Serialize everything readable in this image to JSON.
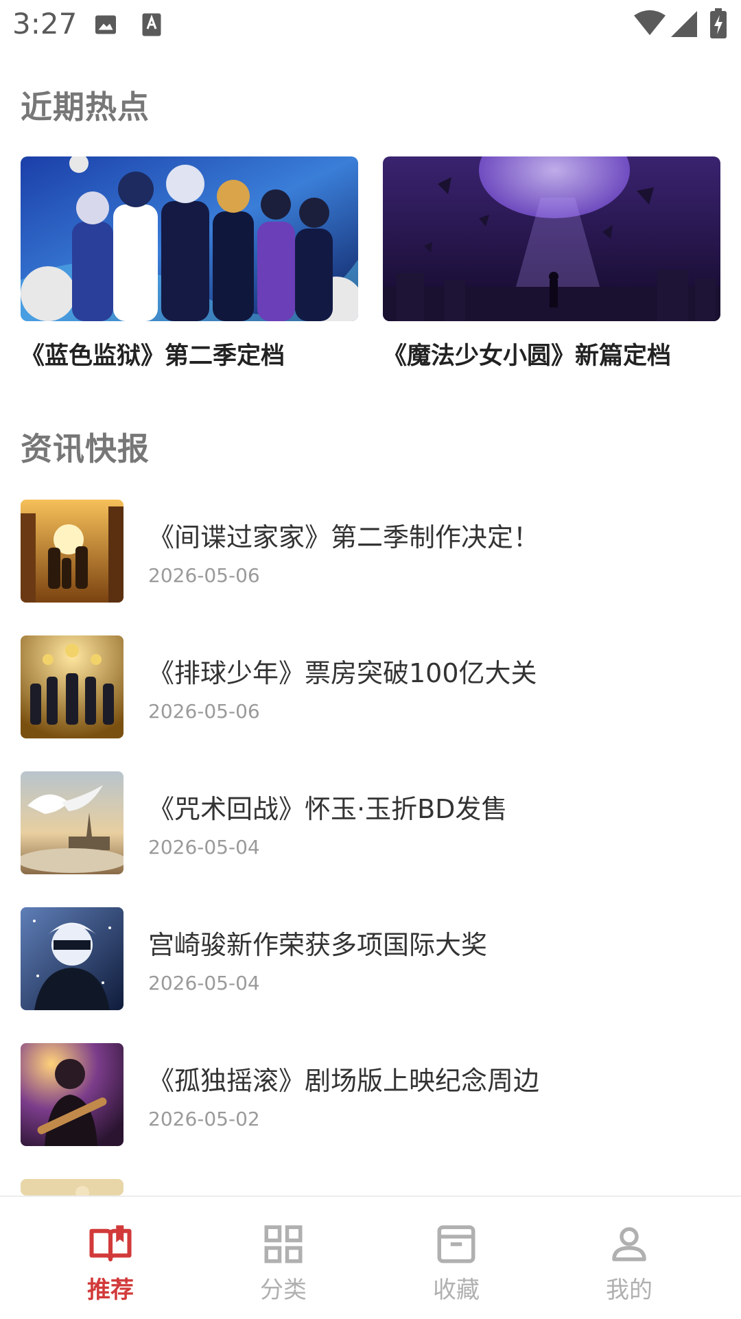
{
  "status_bar": {
    "time": "3:27"
  },
  "sections": {
    "hot": {
      "title": "近期热点"
    },
    "news": {
      "title": "资讯快报"
    }
  },
  "hot_cards": [
    {
      "title": "《蓝色监狱》第二季定档"
    },
    {
      "title": "《魔法少女小圆》新篇定档"
    }
  ],
  "news": [
    {
      "title": "《间谍过家家》第二季制作决定！",
      "date": "2026-05-06"
    },
    {
      "title": "《排球少年》票房突破100亿大关",
      "date": "2026-05-06"
    },
    {
      "title": "《咒术回战》怀玉·玉折BD发售",
      "date": "2026-05-04"
    },
    {
      "title": "宫崎骏新作荣获多项国际大奖",
      "date": "2026-05-04"
    },
    {
      "title": "《孤独摇滚》剧场版上映纪念周边",
      "date": "2026-05-02"
    }
  ],
  "nav": [
    {
      "label": "推荐",
      "icon": "book-open-icon",
      "active": true
    },
    {
      "label": "分类",
      "icon": "grid-icon",
      "active": false
    },
    {
      "label": "收藏",
      "icon": "archive-box-icon",
      "active": false
    },
    {
      "label": "我的",
      "icon": "person-icon",
      "active": false
    }
  ],
  "colors": {
    "accent": "#d23a3a",
    "inactive": "#b0b0b0",
    "section_title": "#777777"
  }
}
